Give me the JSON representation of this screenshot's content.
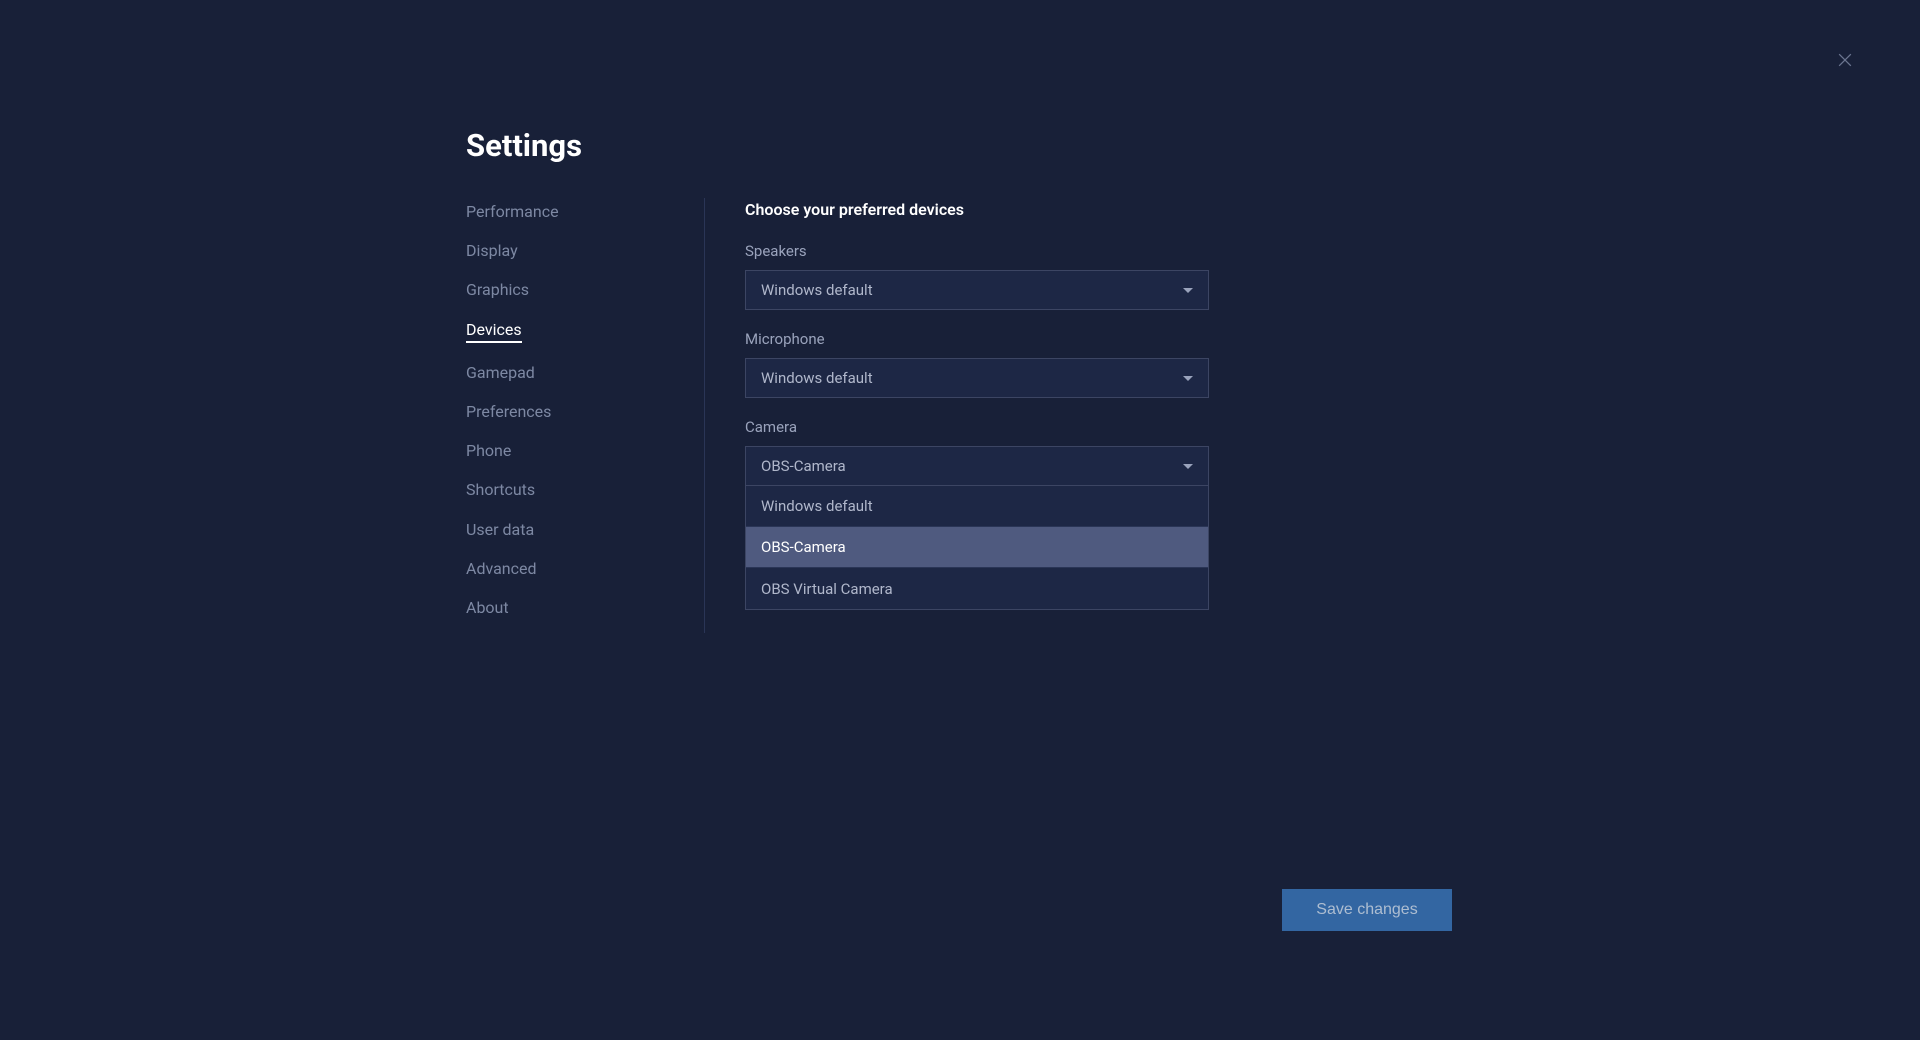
{
  "page_title": "Settings",
  "sidebar": {
    "items": [
      {
        "label": "Performance",
        "active": false
      },
      {
        "label": "Display",
        "active": false
      },
      {
        "label": "Graphics",
        "active": false
      },
      {
        "label": "Devices",
        "active": true
      },
      {
        "label": "Gamepad",
        "active": false
      },
      {
        "label": "Preferences",
        "active": false
      },
      {
        "label": "Phone",
        "active": false
      },
      {
        "label": "Shortcuts",
        "active": false
      },
      {
        "label": "User data",
        "active": false
      },
      {
        "label": "Advanced",
        "active": false
      },
      {
        "label": "About",
        "active": false
      }
    ]
  },
  "content": {
    "heading": "Choose your preferred devices",
    "speakers": {
      "label": "Speakers",
      "value": "Windows default"
    },
    "microphone": {
      "label": "Microphone",
      "value": "Windows default"
    },
    "camera": {
      "label": "Camera",
      "value": "OBS-Camera",
      "options": [
        {
          "label": "Windows default",
          "selected": false
        },
        {
          "label": "OBS-Camera",
          "selected": true
        },
        {
          "label": "OBS Virtual Camera",
          "selected": false
        }
      ]
    }
  },
  "actions": {
    "save": "Save changes"
  }
}
